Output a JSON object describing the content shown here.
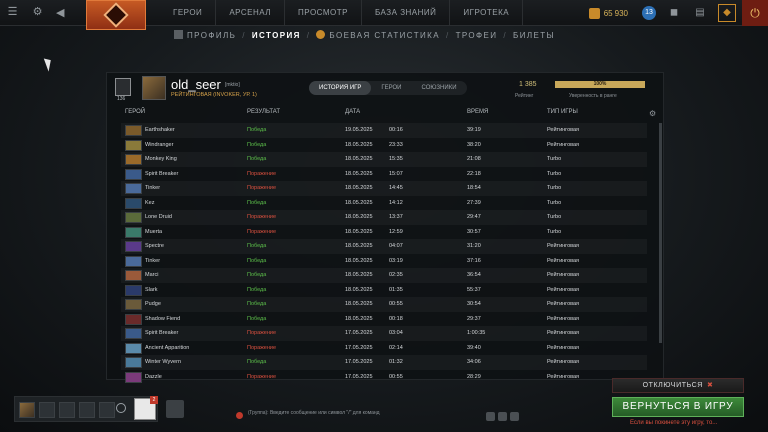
{
  "topbar": {
    "nav": [
      "ГЕРОИ",
      "АРСЕНАЛ",
      "ПРОСМОТР",
      "БАЗА ЗНАНИЙ",
      "ИГРОТЕКА"
    ],
    "currency_1": "65",
    "currency_2": "930",
    "level_badge": "13"
  },
  "subnav": [
    "ПРОФИЛЬ",
    "ИСТОРИЯ",
    "БОЕВАЯ СТАТИСТИКА",
    "ТРОФЕИ",
    "БИЛЕТЫ"
  ],
  "profile": {
    "rank_number": "136",
    "name": "old_seer",
    "tag": "[mktio]",
    "rank_text": "РЕЙТИНГОВАЯ (INVOKER, УР. 1)",
    "tabs": [
      "ИСТОРИЯ ИГР",
      "ГЕРОИ",
      "СОЮЗНИКИ"
    ],
    "mmr": "1 385",
    "mmr_label": "Рейтинг",
    "confidence": "100%",
    "confidence_label": "Уверенность в ранге"
  },
  "table": {
    "headers": [
      "ГЕРОЙ",
      "РЕЗУЛЬТАТ",
      "ДАТА",
      "ВРЕМЯ",
      "ТИП ИГРЫ"
    ],
    "rows": [
      {
        "hero": "Earthshaker",
        "result": "Победа",
        "win": true,
        "date": "19.05.2025",
        "time": "00:16",
        "duration": "39:19",
        "type": "Рейтинговая",
        "color": "#7a5a2a"
      },
      {
        "hero": "Windranger",
        "result": "Победа",
        "win": true,
        "date": "18.05.2025",
        "time": "23:33",
        "duration": "38:20",
        "type": "Рейтинговая",
        "color": "#8a7a3a"
      },
      {
        "hero": "Monkey King",
        "result": "Победа",
        "win": true,
        "date": "18.05.2025",
        "time": "15:35",
        "duration": "21:08",
        "type": "Turbo",
        "color": "#9a6a2a"
      },
      {
        "hero": "Spirit Breaker",
        "result": "Поражение",
        "win": false,
        "date": "18.05.2025",
        "time": "15:07",
        "duration": "22:18",
        "type": "Turbo",
        "color": "#3a5a8a"
      },
      {
        "hero": "Tinker",
        "result": "Поражение",
        "win": false,
        "date": "18.05.2025",
        "time": "14:45",
        "duration": "18:54",
        "type": "Turbo",
        "color": "#4a6a9a"
      },
      {
        "hero": "Kez",
        "result": "Победа",
        "win": true,
        "date": "18.05.2025",
        "time": "14:12",
        "duration": "27:39",
        "type": "Turbo",
        "color": "#2a4a6a"
      },
      {
        "hero": "Lone Druid",
        "result": "Поражение",
        "win": false,
        "date": "18.05.2025",
        "time": "13:37",
        "duration": "29:47",
        "type": "Turbo",
        "color": "#5a6a3a"
      },
      {
        "hero": "Muerta",
        "result": "Поражение",
        "win": false,
        "date": "18.05.2025",
        "time": "12:59",
        "duration": "30:57",
        "type": "Turbo",
        "color": "#3a7a6a"
      },
      {
        "hero": "Spectre",
        "result": "Победа",
        "win": true,
        "date": "18.05.2025",
        "time": "04:07",
        "duration": "31:20",
        "type": "Рейтинговая",
        "color": "#5a3a8a"
      },
      {
        "hero": "Tinker",
        "result": "Победа",
        "win": true,
        "date": "18.05.2025",
        "time": "03:19",
        "duration": "37:16",
        "type": "Рейтинговая",
        "color": "#4a6a9a"
      },
      {
        "hero": "Marci",
        "result": "Победа",
        "win": true,
        "date": "18.05.2025",
        "time": "02:35",
        "duration": "36:54",
        "type": "Рейтинговая",
        "color": "#9a5a3a"
      },
      {
        "hero": "Slark",
        "result": "Победа",
        "win": true,
        "date": "18.05.2025",
        "time": "01:35",
        "duration": "55:37",
        "type": "Рейтинговая",
        "color": "#2a3a6a"
      },
      {
        "hero": "Pudge",
        "result": "Победа",
        "win": true,
        "date": "18.05.2025",
        "time": "00:55",
        "duration": "30:54",
        "type": "Рейтинговая",
        "color": "#6a5a3a"
      },
      {
        "hero": "Shadow Fiend",
        "result": "Победа",
        "win": true,
        "date": "18.05.2025",
        "time": "00:18",
        "duration": "29:37",
        "type": "Рейтинговая",
        "color": "#6a2a2a"
      },
      {
        "hero": "Spirit Breaker",
        "result": "Поражение",
        "win": false,
        "date": "17.05.2025",
        "time": "03:04",
        "duration": "1:00:35",
        "type": "Рейтинговая",
        "color": "#3a5a8a"
      },
      {
        "hero": "Ancient Apparition",
        "result": "Поражение",
        "win": false,
        "date": "17.05.2025",
        "time": "02:14",
        "duration": "39:40",
        "type": "Рейтинговая",
        "color": "#5a8aaa"
      },
      {
        "hero": "Winter Wyvern",
        "result": "Победа",
        "win": true,
        "date": "17.05.2025",
        "time": "01:32",
        "duration": "34:06",
        "type": "Рейтинговая",
        "color": "#4a7a9a"
      },
      {
        "hero": "Dazzle",
        "result": "Поражение",
        "win": false,
        "date": "17.05.2025",
        "time": "00:55",
        "duration": "28:29",
        "type": "Рейтинговая",
        "color": "#7a3a7a"
      }
    ]
  },
  "bottom": {
    "mode_badge": "2",
    "chat_placeholder": "(Группа): Введите сообщение или символ \"/\" для команд",
    "disconnect": "ОТКЛЮЧИТЬСЯ",
    "return": "ВЕРНУТЬСЯ В ИГРУ",
    "return_hint": "Если вы покинете эту игру, то..."
  },
  "colors": {
    "win": "#5cbf4a",
    "loss": "#d9503f",
    "accent_orange": "#c65a24",
    "return_green": "#3d8a3a"
  }
}
